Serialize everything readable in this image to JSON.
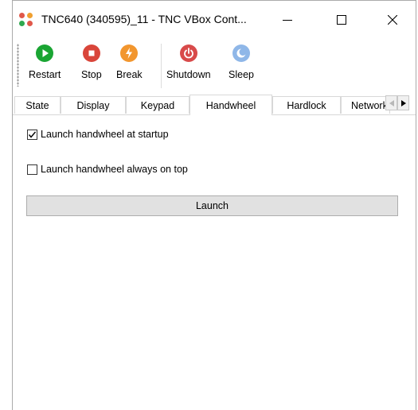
{
  "window": {
    "title": "TNC640 (340595)_11 - TNC VBox Cont...",
    "icon": "app-dots-icon"
  },
  "toolbar": {
    "items": [
      {
        "label": "Restart",
        "icon": "restart-play-icon",
        "color": "#1aa533"
      },
      {
        "label": "Stop",
        "icon": "stop-icon",
        "color": "#d9453a"
      },
      {
        "label": "Break",
        "icon": "break-lightning-icon",
        "color": "#f2962e"
      },
      {
        "label": "Shutdown",
        "icon": "power-icon",
        "color": "#d84a4a"
      },
      {
        "label": "Sleep",
        "icon": "sleep-moon-icon",
        "color": "#8fb7e8"
      }
    ]
  },
  "tabs": {
    "items": [
      "State",
      "Display",
      "Keypad",
      "Handwheel",
      "Hardlock",
      "Network"
    ],
    "active": "Handwheel"
  },
  "handwheel": {
    "startup_label": "Launch handwheel at startup",
    "startup_checked": true,
    "ontop_label": "Launch handwheel always on top",
    "ontop_checked": false,
    "launch_label": "Launch"
  }
}
